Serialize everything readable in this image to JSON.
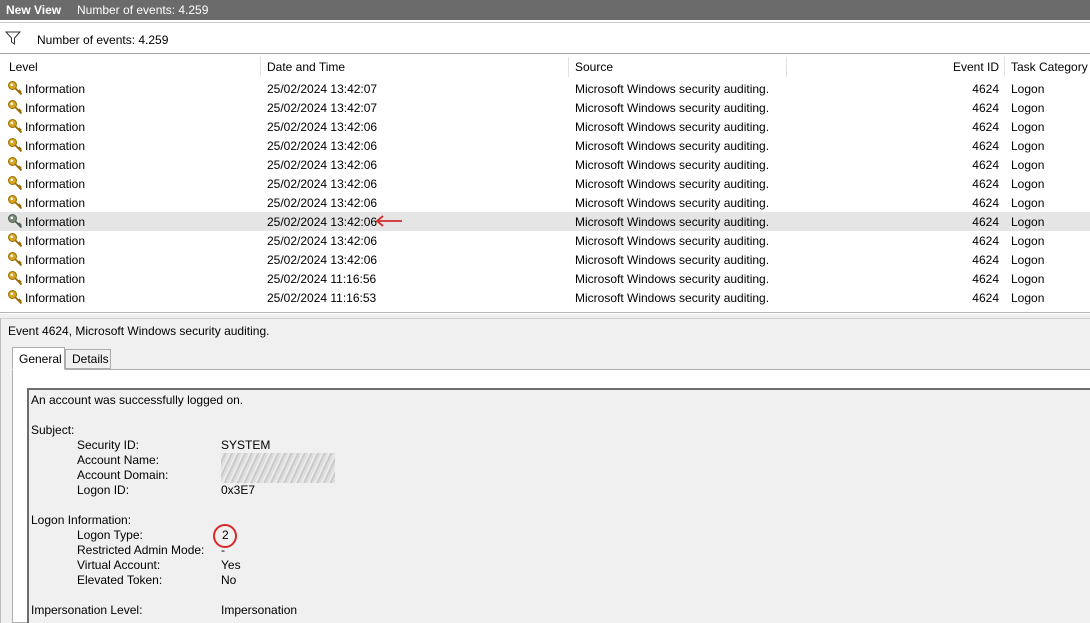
{
  "titlebar": {
    "view_name": "New View",
    "event_count": "Number of events: 4.259"
  },
  "filterbar": {
    "icon": "filter-icon",
    "text": "Number of events: 4.259"
  },
  "columns": {
    "level": "Level",
    "date": "Date and Time",
    "source": "Source",
    "event_id": "Event ID",
    "category": "Task Category"
  },
  "rows": [
    {
      "level": "Information",
      "date": "25/02/2024 13:42:07",
      "source": "Microsoft Windows security auditing.",
      "id": "4624",
      "category": "Logon"
    },
    {
      "level": "Information",
      "date": "25/02/2024 13:42:07",
      "source": "Microsoft Windows security auditing.",
      "id": "4624",
      "category": "Logon"
    },
    {
      "level": "Information",
      "date": "25/02/2024 13:42:06",
      "source": "Microsoft Windows security auditing.",
      "id": "4624",
      "category": "Logon"
    },
    {
      "level": "Information",
      "date": "25/02/2024 13:42:06",
      "source": "Microsoft Windows security auditing.",
      "id": "4624",
      "category": "Logon"
    },
    {
      "level": "Information",
      "date": "25/02/2024 13:42:06",
      "source": "Microsoft Windows security auditing.",
      "id": "4624",
      "category": "Logon"
    },
    {
      "level": "Information",
      "date": "25/02/2024 13:42:06",
      "source": "Microsoft Windows security auditing.",
      "id": "4624",
      "category": "Logon"
    },
    {
      "level": "Information",
      "date": "25/02/2024 13:42:06",
      "source": "Microsoft Windows security auditing.",
      "id": "4624",
      "category": "Logon"
    },
    {
      "level": "Information",
      "date": "25/02/2024 13:42:06",
      "source": "Microsoft Windows security auditing.",
      "id": "4624",
      "category": "Logon",
      "selected": true
    },
    {
      "level": "Information",
      "date": "25/02/2024 13:42:06",
      "source": "Microsoft Windows security auditing.",
      "id": "4624",
      "category": "Logon"
    },
    {
      "level": "Information",
      "date": "25/02/2024 13:42:06",
      "source": "Microsoft Windows security auditing.",
      "id": "4624",
      "category": "Logon"
    },
    {
      "level": "Information",
      "date": "25/02/2024 11:16:56",
      "source": "Microsoft Windows security auditing.",
      "id": "4624",
      "category": "Logon"
    },
    {
      "level": "Information",
      "date": "25/02/2024 11:16:53",
      "source": "Microsoft Windows security auditing.",
      "id": "4624",
      "category": "Logon"
    }
  ],
  "detail": {
    "title": "Event 4624, Microsoft Windows security auditing.",
    "tabs": {
      "general": "General",
      "details": "Details"
    },
    "body": {
      "intro": "An account was successfully logged on.",
      "subject_heading": "Subject:",
      "security_id_label": "Security ID:",
      "security_id_value": "SYSTEM",
      "account_name_label": "Account Name:",
      "account_domain_label": "Account Domain:",
      "logon_id_label": "Logon ID:",
      "logon_id_value": "0x3E7",
      "logon_info_heading": "Logon Information:",
      "logon_type_label": "Logon Type:",
      "logon_type_value": "2",
      "restricted_label": "Restricted Admin Mode:",
      "restricted_value": "-",
      "virtual_label": "Virtual Account:",
      "virtual_value": "Yes",
      "elevated_label": "Elevated Token:",
      "elevated_value": "No",
      "impersonation_label": "Impersonation Level:",
      "impersonation_value": "Impersonation"
    }
  },
  "colors": {
    "titlebar_bg": "#6b6b6b",
    "selected_row": "#e5e5e5",
    "annotation_red": "#d42a2a",
    "panel_bg": "#f0f0f0"
  }
}
